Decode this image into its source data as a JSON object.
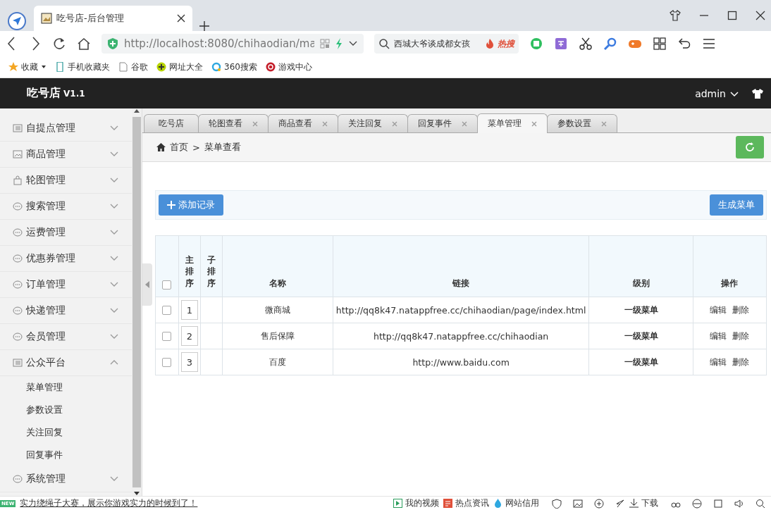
{
  "browser": {
    "tab_title": "吃号店-后台管理",
    "address": "http://localhost:8080/chihaodian/ma",
    "search": {
      "value": "西城大爷谈成都女孩",
      "hot": "热搜"
    },
    "bookmarks": [
      "收藏",
      "手机收藏夹",
      "谷歌",
      "网址大全",
      "360搜索",
      "游戏中心"
    ]
  },
  "app": {
    "brand": "吃号店",
    "version": "V1.1",
    "user": "admin"
  },
  "sidebar": {
    "items": [
      {
        "label": "自提点管理",
        "expanded": false
      },
      {
        "label": "商品管理",
        "expanded": false
      },
      {
        "label": "轮图管理",
        "expanded": false
      },
      {
        "label": "搜索管理",
        "expanded": false
      },
      {
        "label": "运费管理",
        "expanded": false
      },
      {
        "label": "优惠券管理",
        "expanded": false
      },
      {
        "label": "订单管理",
        "expanded": false
      },
      {
        "label": "快递管理",
        "expanded": false
      },
      {
        "label": "会员管理",
        "expanded": false
      },
      {
        "label": "公众平台",
        "expanded": true,
        "children": [
          {
            "label": "菜单管理"
          },
          {
            "label": "参数设置"
          },
          {
            "label": "关注回复"
          },
          {
            "label": "回复事件"
          }
        ]
      },
      {
        "label": "系统管理",
        "expanded": false
      }
    ]
  },
  "tabs": [
    {
      "label": "吃号店",
      "selected": false,
      "closable": false
    },
    {
      "label": "轮图查看",
      "selected": false,
      "closable": true
    },
    {
      "label": "商品查看",
      "selected": false,
      "closable": true
    },
    {
      "label": "关注回复",
      "selected": false,
      "closable": true
    },
    {
      "label": "回复事件",
      "selected": false,
      "closable": true
    },
    {
      "label": "菜单管理",
      "selected": true,
      "closable": true
    },
    {
      "label": "参数设置",
      "selected": false,
      "closable": true
    }
  ],
  "breadcrumb": {
    "home": "首页",
    "separator": ">",
    "current": "菜单查看"
  },
  "toolbar": {
    "add_button": "添加记录",
    "generate_button": "生成菜单"
  },
  "table": {
    "header_checked": false,
    "columns": [
      "主排序",
      "子排序",
      "名称",
      "链接",
      "级别",
      "操作"
    ],
    "rows": [
      {
        "checked": false,
        "main_order": "1",
        "name": "微商城",
        "link": "http://qq8k47.natappfree.cc/chihaodian/page/index.html",
        "level": "一级菜单",
        "actions": [
          "编辑",
          "删除"
        ]
      },
      {
        "checked": false,
        "main_order": "2",
        "name": "售后保障",
        "link": "http://qq8k47.natappfree.cc/chihaodian",
        "level": "一级菜单",
        "actions": [
          "编辑",
          "删除"
        ]
      },
      {
        "checked": false,
        "main_order": "3",
        "name": "百度",
        "link": "http://www.baidu.com",
        "level": "一级菜单",
        "actions": [
          "编辑",
          "删除"
        ]
      }
    ]
  },
  "status_bar": {
    "badge": "NEW",
    "news": "实力绕绳子大赛，展示你游戏实力的时候到了！",
    "items": [
      "我的视频",
      "热点资讯",
      "网站信用",
      "下载"
    ]
  }
}
